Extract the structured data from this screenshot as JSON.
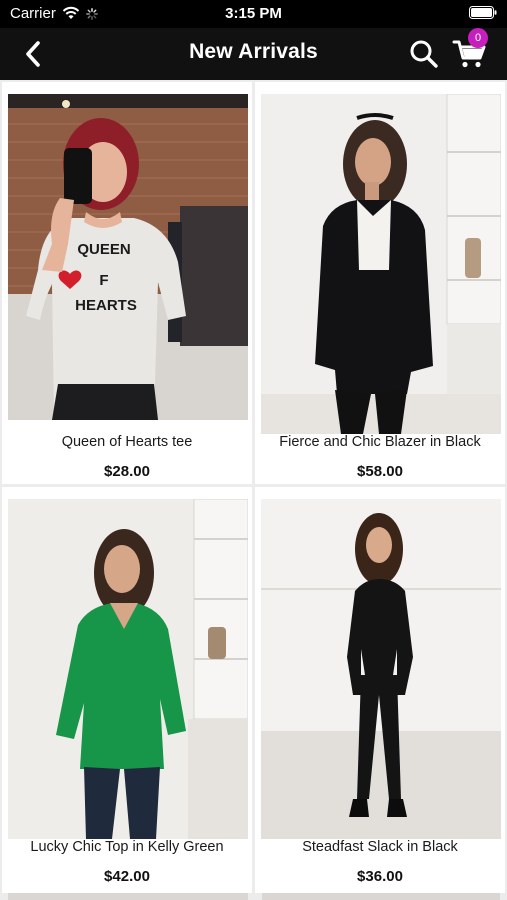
{
  "status_bar": {
    "carrier": "Carrier",
    "time": "3:15 PM"
  },
  "nav": {
    "title": "New Arrivals",
    "back_icon": "chevron-left-icon",
    "search_icon": "search-icon",
    "cart_icon": "cart-icon",
    "cart_count": "0",
    "badge_color": "#c51fbd"
  },
  "products": [
    {
      "name": "Queen of Hearts tee",
      "price": "$28.00"
    },
    {
      "name": "Fierce and Chic Blazer in Black",
      "price": "$58.00"
    },
    {
      "name": "Lucky Chic Top in Kelly Green",
      "price": "$42.00"
    },
    {
      "name": "Steadfast Slack in Black",
      "price": "$36.00"
    }
  ],
  "theme": {
    "header_bg": "#111111",
    "page_bg": "#ececec",
    "card_bg": "#ffffff"
  }
}
